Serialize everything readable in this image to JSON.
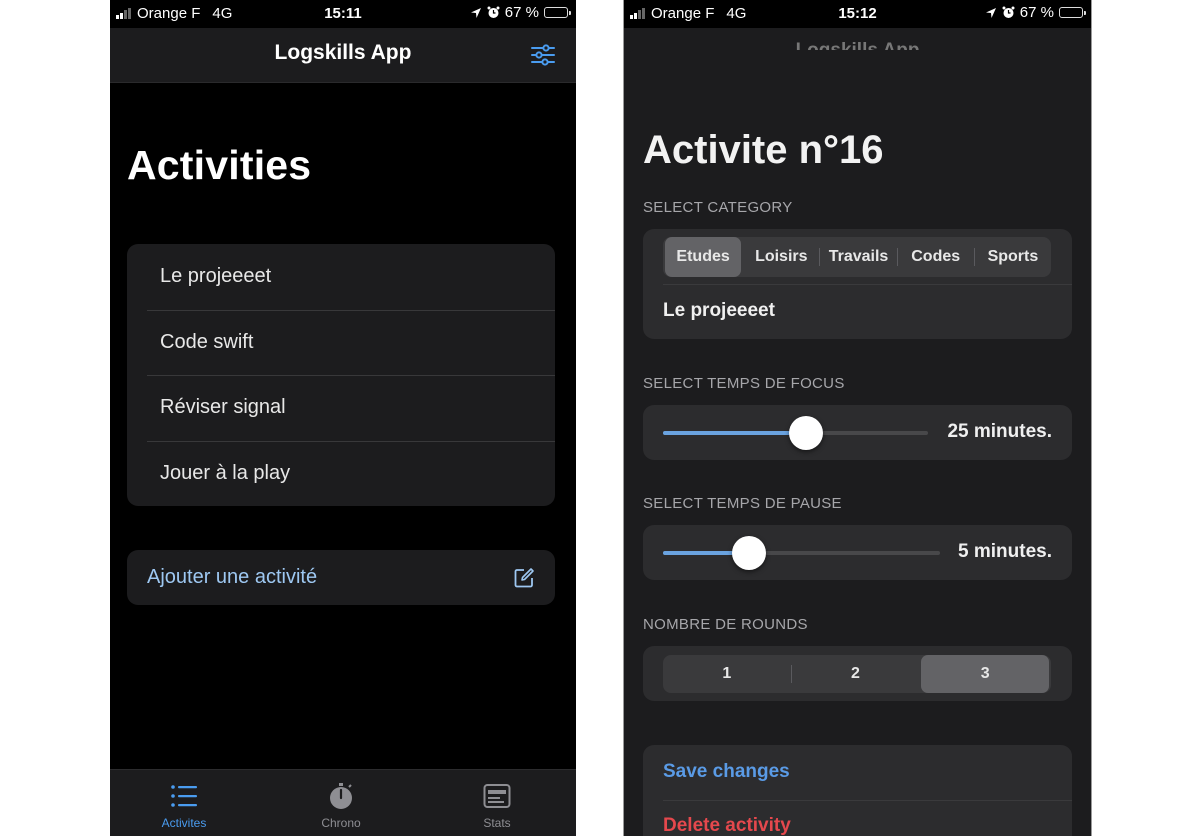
{
  "left_screen": {
    "status": {
      "carrier": "Orange F",
      "network": "4G",
      "time": "15:11",
      "battery": "67 %",
      "battery_level": 0.67
    },
    "nav_title": "Logskills App",
    "large_title": "Activities",
    "activities": [
      {
        "label": "Le projeeeet"
      },
      {
        "label": "Code swift"
      },
      {
        "label": "Réviser signal"
      },
      {
        "label": "Jouer à la play"
      }
    ],
    "add_label": "Ajouter une activité",
    "tabs": [
      {
        "label": "Activites",
        "icon": "list-icon",
        "active": true
      },
      {
        "label": "Chrono",
        "icon": "stopwatch-icon",
        "active": false
      },
      {
        "label": "Stats",
        "icon": "stats-icon",
        "active": false
      }
    ],
    "colors": {
      "accent": "#4a9cf0",
      "add_text": "#9ec8f2"
    }
  },
  "right_screen": {
    "status": {
      "carrier": "Orange F",
      "network": "4G",
      "time": "15:12",
      "battery": "67 %",
      "battery_level": 0.67
    },
    "underlying_title": "Logskills App",
    "title": "Activite n°16",
    "category_header": "SELECT CATEGORY",
    "categories": [
      "Etudes",
      "Loisirs",
      "Travails",
      "Codes",
      "Sports"
    ],
    "selected_category": "Etudes",
    "activity_name": "Le projeeeet",
    "focus_header": "SELECT TEMPS DE FOCUS",
    "focus_value": "25 minutes.",
    "focus_level": 0.54,
    "pause_header": "SELECT TEMPS DE PAUSE",
    "pause_value": "5 minutes.",
    "pause_level": 0.31,
    "rounds_header": "NOMBRE DE ROUNDS",
    "rounds": [
      "1",
      "2",
      "3"
    ],
    "selected_round": "3",
    "save_label": "Save changes",
    "delete_label": "Delete activity",
    "colors": {
      "save": "#5a9be6",
      "delete": "#e5484d",
      "slider": "#6aa3e0"
    }
  }
}
